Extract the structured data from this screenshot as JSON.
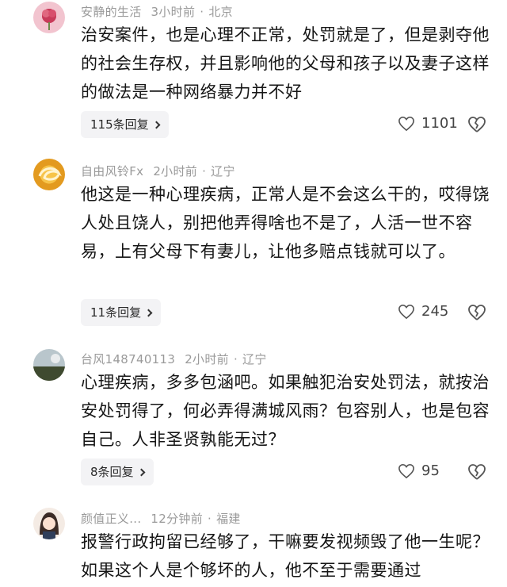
{
  "comments": [
    {
      "user": "安静的生活",
      "time": "3小时前",
      "location": "北京",
      "text": "治安案件，也是心理不正常，处罚就是了，但是剥夺他的社会生存权，并且影响他的父母和孩子以及妻子这样的做法是一种网络暴力并不好",
      "replies": "115条回复",
      "likes": "1101",
      "avatar_icon": "pink-flower-avatar"
    },
    {
      "user": "自由风铃Fx",
      "time": "2小时前",
      "location": "辽宁",
      "text": "他这是一种心理疾病，正常人是不会这么干的，哎得饶人处且饶人，别把他弄得啥也不是了，人活一世不容易，上有父母下有妻儿，让他多赔点钱就可以了。",
      "replies": "11条回复",
      "likes": "245",
      "avatar_icon": "golden-swirl-avatar"
    },
    {
      "user": "台风148740113",
      "time": "2小时前",
      "location": "辽宁",
      "text": "心理疾病，多多包涵吧。如果触犯治安处罚法，就按治安处罚得了，何必弄得满城风雨？包容别人，也是包容自己。人非圣贤孰能无过？",
      "replies": "8条回复",
      "likes": "95",
      "avatar_icon": "landscape-photo-avatar"
    },
    {
      "user": "颜值正义...",
      "time": "12分钟前",
      "location": "福建",
      "text": "报警行政拘留已经够了，干嘛要发视频毁了他一生呢？如果这个人是个够坏的人，他不至于需要通过",
      "avatar_icon": "cartoon-girl-avatar"
    }
  ],
  "colors": {
    "meta": "#9a9a9a",
    "reply_bg": "#f3f3f5",
    "text": "#161616"
  }
}
